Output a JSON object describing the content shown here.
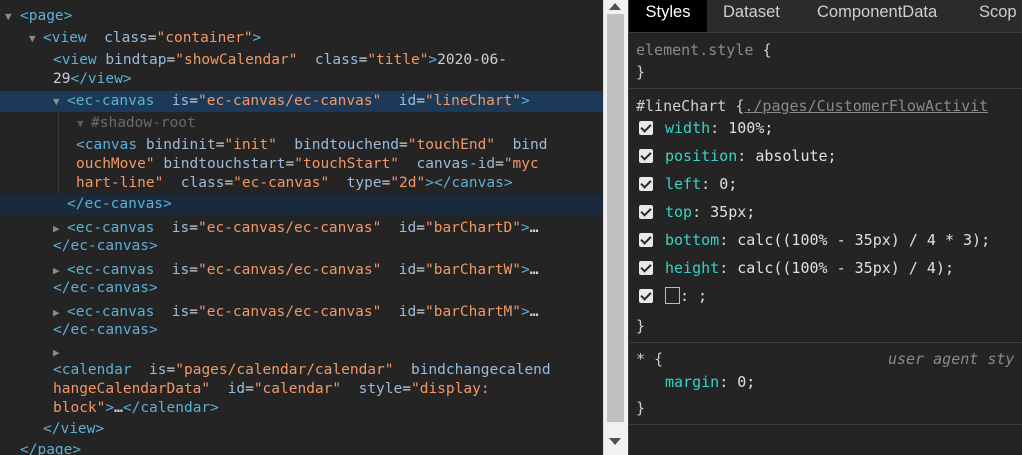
{
  "elements_tree": {
    "page_open": "<page>",
    "view_open": {
      "tag": "<view",
      "attr": "class",
      "value": "\"container\"",
      "close": ">"
    },
    "title_view": {
      "tag": "<view",
      "attr1": "bindtap",
      "val1": "\"showCalendar\"",
      "attr2": "class",
      "val2": "\"title\"",
      "close": ">",
      "text_line1": "2020-06-",
      "text_line2": "29",
      "end_tag": "</view>"
    },
    "ec_line": {
      "tag": "<ec-canvas",
      "attr1": "is",
      "val1": "\"ec-canvas/ec-canvas\"",
      "attr2": "id",
      "val2": "\"lineChart\"",
      "close": ">"
    },
    "shadow_root": "#shadow-root",
    "canvas": {
      "tag": "<canvas",
      "attr1": "bindinit",
      "val1": "\"init\"",
      "attr2": "bindtouchend",
      "val2": "\"touchEnd\"",
      "attr3": "bind",
      "line2_prefix": "ouchMove\"",
      "attr4": "bindtouchstart",
      "val4": "\"touchStart\"",
      "attr5": "canvas-id",
      "val5": "\"myc",
      "line3_prefix": "hart-line\"",
      "attr6": "class",
      "val6": "\"ec-canvas\"",
      "attr7": "type",
      "val7": "\"2d\"",
      "close": "></canvas>"
    },
    "ec_close": "</ec-canvas>",
    "bar_charts": [
      {
        "tag": "<ec-canvas",
        "attr1": "is",
        "val1": "\"ec-canvas/ec-canvas\"",
        "attr2": "id",
        "val2": "\"barChartD\"",
        "close": ">",
        "ellipsis": "…",
        "end": "</ec-canvas>"
      },
      {
        "tag": "<ec-canvas",
        "attr1": "is",
        "val1": "\"ec-canvas/ec-canvas\"",
        "attr2": "id",
        "val2": "\"barChartW\"",
        "close": ">",
        "ellipsis": "…",
        "end": "</ec-canvas>"
      },
      {
        "tag": "<ec-canvas",
        "attr1": "is",
        "val1": "\"ec-canvas/ec-canvas\"",
        "attr2": "id",
        "val2": "\"barChartM\"",
        "close": ">",
        "ellipsis": "…",
        "end": "</ec-canvas>"
      }
    ],
    "calendar": {
      "tag": "<calendar",
      "attr1": "is",
      "val1": "\"pages/calendar/calendar\"",
      "attr2": "bindchangecalend",
      "line2_val": "hangeCalendarData\"",
      "attr3": "id",
      "val3": "\"calendar\"",
      "attr4": "style",
      "val4a": "\"display:",
      "line3_val": "block\"",
      "close": ">",
      "ellipsis": "…",
      "end": "</calendar>"
    },
    "view_close": "</view>",
    "page_close": "</page>"
  },
  "styles_panel": {
    "tabs": [
      "Styles",
      "Dataset",
      "ComponentData",
      "Scop"
    ],
    "active_tab": "Styles",
    "element_style": {
      "selector": "element.style",
      "open": "{",
      "close": "}"
    },
    "rule": {
      "selector": "#lineChart",
      "open": "{",
      "source": "./pages/CustomerFlowActivit",
      "declarations": [
        {
          "prop": "width",
          "value": "100%;"
        },
        {
          "prop": "position",
          "value": "absolute;"
        },
        {
          "prop": "left",
          "value": "0;"
        },
        {
          "prop": "top",
          "value": "35px;"
        },
        {
          "prop": "bottom",
          "value": "calc((100% - 35px) / 4 * 3);"
        },
        {
          "prop": "height",
          "value": "calc((100% - 35px) / 4);"
        }
      ],
      "empty_decl": ": ;",
      "close": "}"
    },
    "ua_rule": {
      "selector": "*",
      "open": "{",
      "source": "user agent sty",
      "prop": "margin",
      "value": "0;",
      "close": "}"
    }
  },
  "colors": {
    "background": "#242424",
    "selected_row": "#1c3a57",
    "tag": "#5db0d7",
    "attribute": "#9bbbdc",
    "attr_value": "#f29766",
    "css_property": "#35d4c7"
  }
}
